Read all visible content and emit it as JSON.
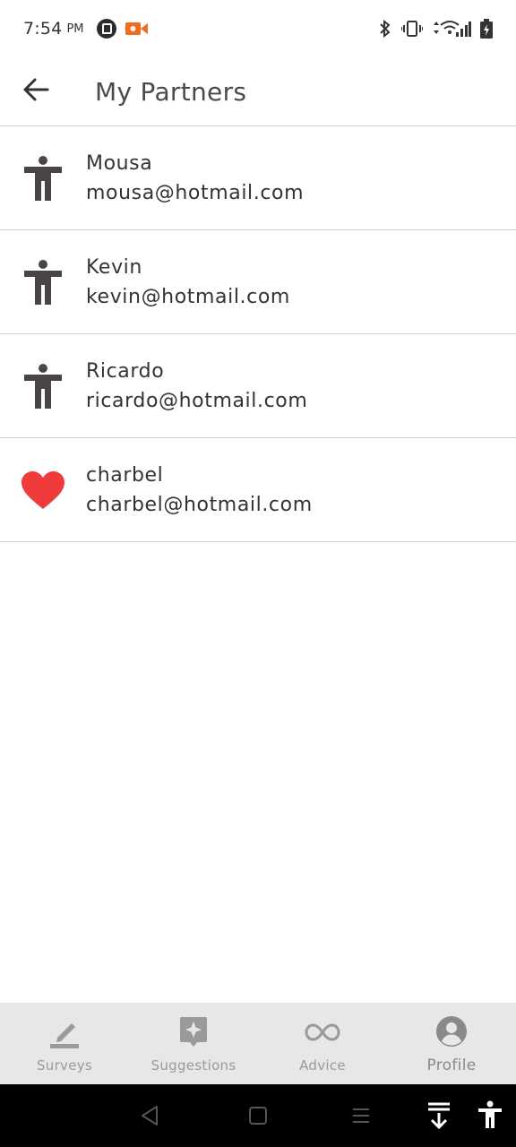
{
  "status_bar": {
    "time": "7:54",
    "ampm": "PM"
  },
  "app_bar": {
    "title": "My Partners"
  },
  "partners": [
    {
      "name": "Mousa",
      "email": "mousa@hotmail.com",
      "icon": "accessibility-person-icon"
    },
    {
      "name": "Kevin",
      "email": "kevin@hotmail.com",
      "icon": "accessibility-person-icon"
    },
    {
      "name": "Ricardo",
      "email": "ricardo@hotmail.com",
      "icon": "accessibility-person-icon"
    },
    {
      "name": "charbel",
      "email": "charbel@hotmail.com",
      "icon": "heart-icon"
    }
  ],
  "bottom_nav": {
    "items": [
      {
        "label": "Surveys",
        "icon": "pencil-icon"
      },
      {
        "label": "Suggestions",
        "icon": "sparkle-bubble-icon"
      },
      {
        "label": "Advice",
        "icon": "infinity-icon"
      },
      {
        "label": "Profile",
        "icon": "account-circle-icon",
        "active": true
      }
    ]
  },
  "colors": {
    "heart": "#ef3b3b",
    "person_icon": "#4a4444",
    "nav_background": "#e7e7e7",
    "divider": "#cfcfcf"
  }
}
